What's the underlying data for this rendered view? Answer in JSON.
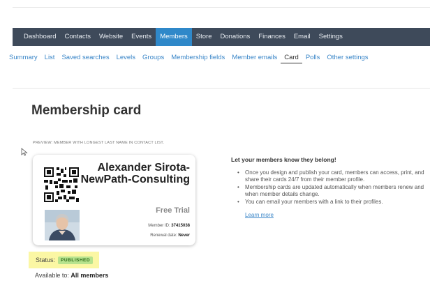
{
  "main_nav": [
    {
      "label": "Dashboard",
      "active": false
    },
    {
      "label": "Contacts",
      "active": false
    },
    {
      "label": "Website",
      "active": false
    },
    {
      "label": "Events",
      "active": false
    },
    {
      "label": "Members",
      "active": true
    },
    {
      "label": "Store",
      "active": false
    },
    {
      "label": "Donations",
      "active": false
    },
    {
      "label": "Finances",
      "active": false
    },
    {
      "label": "Email",
      "active": false
    },
    {
      "label": "Settings",
      "active": false
    }
  ],
  "sub_nav": [
    {
      "label": "Summary",
      "active": false
    },
    {
      "label": "List",
      "active": false
    },
    {
      "label": "Saved searches",
      "active": false
    },
    {
      "label": "Levels",
      "active": false
    },
    {
      "label": "Groups",
      "active": false
    },
    {
      "label": "Membership fields",
      "active": false
    },
    {
      "label": "Member emails",
      "active": false
    },
    {
      "label": "Card",
      "active": true
    },
    {
      "label": "Polls",
      "active": false
    },
    {
      "label": "Other settings",
      "active": false
    }
  ],
  "page": {
    "title": "Membership card",
    "preview_label": "Preview: member with longest last name in contact list."
  },
  "card": {
    "name": "Alexander Sirota-NewPath-Consulting",
    "plan": "Free Trial",
    "member_id_label": "Member ID:",
    "member_id_value": "37415038",
    "renewal_label": "Renewal date:",
    "renewal_value": "Never"
  },
  "status": {
    "label": "Status:",
    "badge": "PUBLISHED",
    "available_label": "Available to:",
    "available_value": "All members"
  },
  "info": {
    "heading": "Let your members know they belong!",
    "bullets": [
      "Once you design and publish your card, members can access, print, and share their cards 24/7 from their member profile.",
      "Membership cards are updated automatically when members renew and when member details change.",
      "You can email your members with a link to their profiles."
    ],
    "link": "Learn more"
  },
  "colors": {
    "nav_bg": "#3e4a5a",
    "nav_active": "#2f88c9",
    "link": "#3a86c8",
    "status_highlight": "#fbf7a4",
    "badge_bg": "#b7e38e"
  }
}
